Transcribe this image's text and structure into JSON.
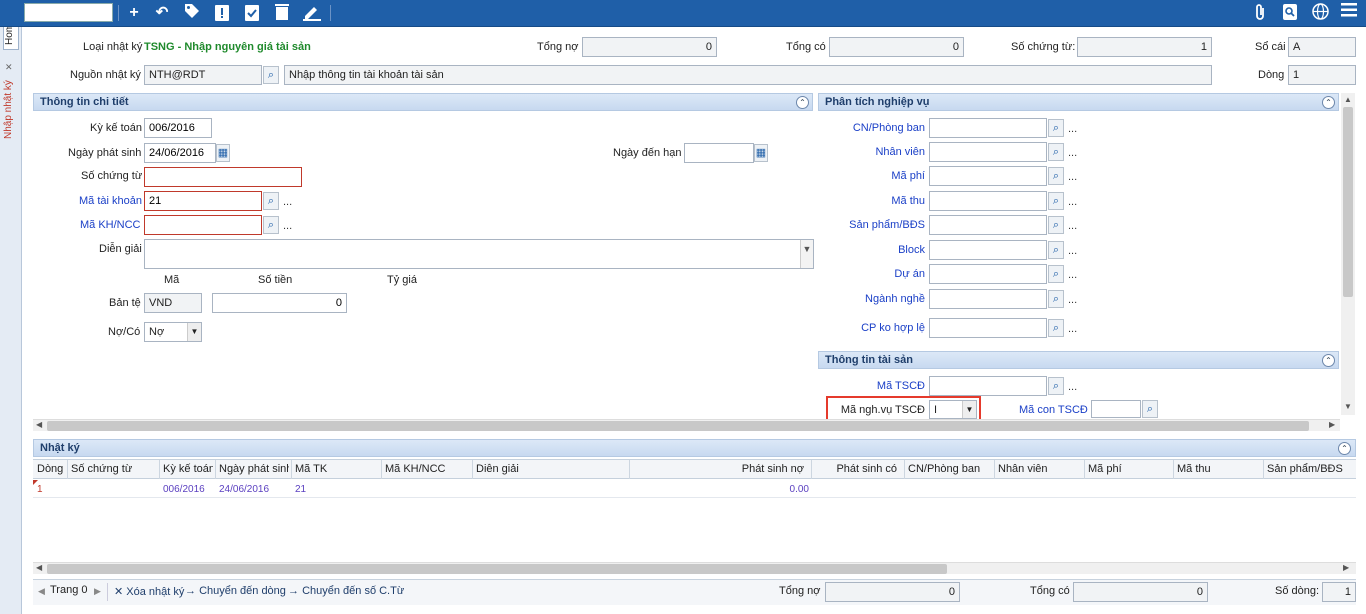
{
  "left_tabs": {
    "home": "Home",
    "journal": "Nhập nhật ký"
  },
  "toolbar": {
    "search_value": ""
  },
  "header": {
    "journal_type_label": "Loại nhật ký",
    "journal_type_value": "TSNG - Nhập nguyên giá tài sản",
    "total_debit_label": "Tổng nợ",
    "total_debit_value": "0",
    "total_credit_label": "Tổng có",
    "total_credit_value": "0",
    "doc_count_label": "Số chứng từ:",
    "doc_count_value": "1",
    "ledger_label": "Sổ cái",
    "ledger_value": "A",
    "source_label": "Nguồn nhật ký",
    "source_value": "NTH@RDT",
    "source_desc": "Nhập thông tin tài khoản tài sản",
    "line_label": "Dòng",
    "line_value": "1"
  },
  "detail": {
    "title": "Thông tin chi tiết",
    "period_label": "Kỳ kế toán",
    "period_value": "006/2016",
    "date_label": "Ngày phát sinh",
    "date_value": "24/06/2016",
    "due_label": "Ngày đến hạn",
    "due_value": "",
    "doc_label": "Số chứng từ",
    "doc_value": "",
    "account_label": "Mã tài khoản",
    "account_value": "21",
    "partner_label": "Mã KH/NCC",
    "partner_value": "",
    "desc_label": "Diễn giải",
    "desc_value": "",
    "col_code": "Mã",
    "col_amount": "Số tiền",
    "col_rate": "Tỷ giá",
    "currency_label": "Bản tệ",
    "currency_value": "VND",
    "currency_amount": "0",
    "dc_label": "Nợ/Có",
    "dc_value": "Nợ"
  },
  "analysis": {
    "title": "Phân tích nghiệp vụ",
    "fields": [
      {
        "label": "CN/Phòng ban"
      },
      {
        "label": "Nhân viên"
      },
      {
        "label": "Mã phí"
      },
      {
        "label": "Mã thu"
      },
      {
        "label": "Sản phẩm/BĐS"
      },
      {
        "label": "Block"
      },
      {
        "label": "Dự án"
      },
      {
        "label": "Ngành nghề"
      },
      {
        "label": "CP ko hợp lệ"
      }
    ]
  },
  "asset": {
    "title": "Thông tin tài sản",
    "code_label": "Mã TSCĐ",
    "op_label": "Mã ngh.vụ TSCĐ",
    "op_value": "I",
    "sub_label": "Mã con TSCĐ"
  },
  "journal": {
    "title": "Nhật ký",
    "columns": [
      "Dòng",
      "Số chứng từ",
      "Kỳ kế toán",
      "Ngày phát sinh",
      "Mã TK",
      "Mã KH/NCC",
      "Diễn giải",
      "Phát sinh nợ",
      "Phát sinh có",
      "CN/Phòng ban",
      "Nhân viên",
      "Mã phí",
      "Mã thu",
      "Sản phẩm/BĐS"
    ],
    "rows": [
      {
        "line": "1",
        "period": "006/2016",
        "date": "24/06/2016",
        "account": "21",
        "debit": "0.00"
      }
    ]
  },
  "footer": {
    "page_label": "Trang 0",
    "delete_label": "Xóa nhật ký",
    "goto_line_label": "Chuyển đến dòng",
    "goto_doc_label": "Chuyển đến số C.Từ",
    "total_debit_label": "Tổng nợ",
    "total_debit_value": "0",
    "total_credit_label": "Tổng có",
    "total_credit_value": "0",
    "rows_label": "Số dòng:",
    "rows_value": "1"
  }
}
